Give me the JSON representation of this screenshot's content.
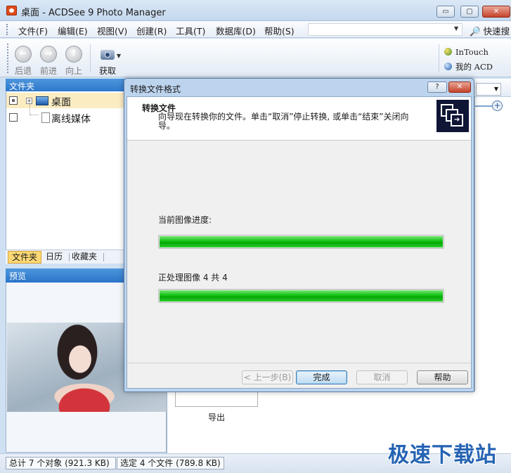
{
  "window": {
    "title": "桌面 - ACDSee 9 Photo Manager",
    "controls": {
      "minimize": "▭",
      "maximize": "▢",
      "close": "✕"
    }
  },
  "menu": {
    "items": [
      "文件(F)",
      "编辑(E)",
      "视图(V)",
      "创建(R)",
      "工具(T)",
      "数据库(D)",
      "帮助(S)"
    ],
    "quick_search": "快速搜"
  },
  "toolbar": {
    "back": "后退",
    "forward": "前进",
    "up": "向上",
    "acquire": "获取",
    "links": [
      "InTouch",
      "我的 ACD"
    ]
  },
  "folders_panel": {
    "title": "文件夹",
    "items": [
      "桌面",
      "离线媒体"
    ],
    "tabs": [
      "文件夹",
      "日历",
      "收藏夹"
    ]
  },
  "preview_panel": {
    "title": "预览"
  },
  "content": {
    "thumb_label": "导出"
  },
  "status": {
    "total": "总计 7 个对象 (921.3 KB)",
    "selected": "选定 4 个文件 (789.8 KB)"
  },
  "watermark": "极速下载站",
  "dialog": {
    "title": "转换文件格式",
    "help_btn": "?",
    "close_btn": "✕",
    "header_title": "转换文件",
    "header_desc": "向导现在转换你的文件。单击“取消”停止转换, 或单击“结束”关闭向导。",
    "current_progress_label": "当前图像进度:",
    "current_progress": 1.0,
    "overall_label": "正处理图像 4 共 4",
    "overall_progress": 1.0,
    "buttons": {
      "back": "< 上一步(B)",
      "finish": "完成",
      "cancel": "取消",
      "help": "帮助"
    }
  }
}
